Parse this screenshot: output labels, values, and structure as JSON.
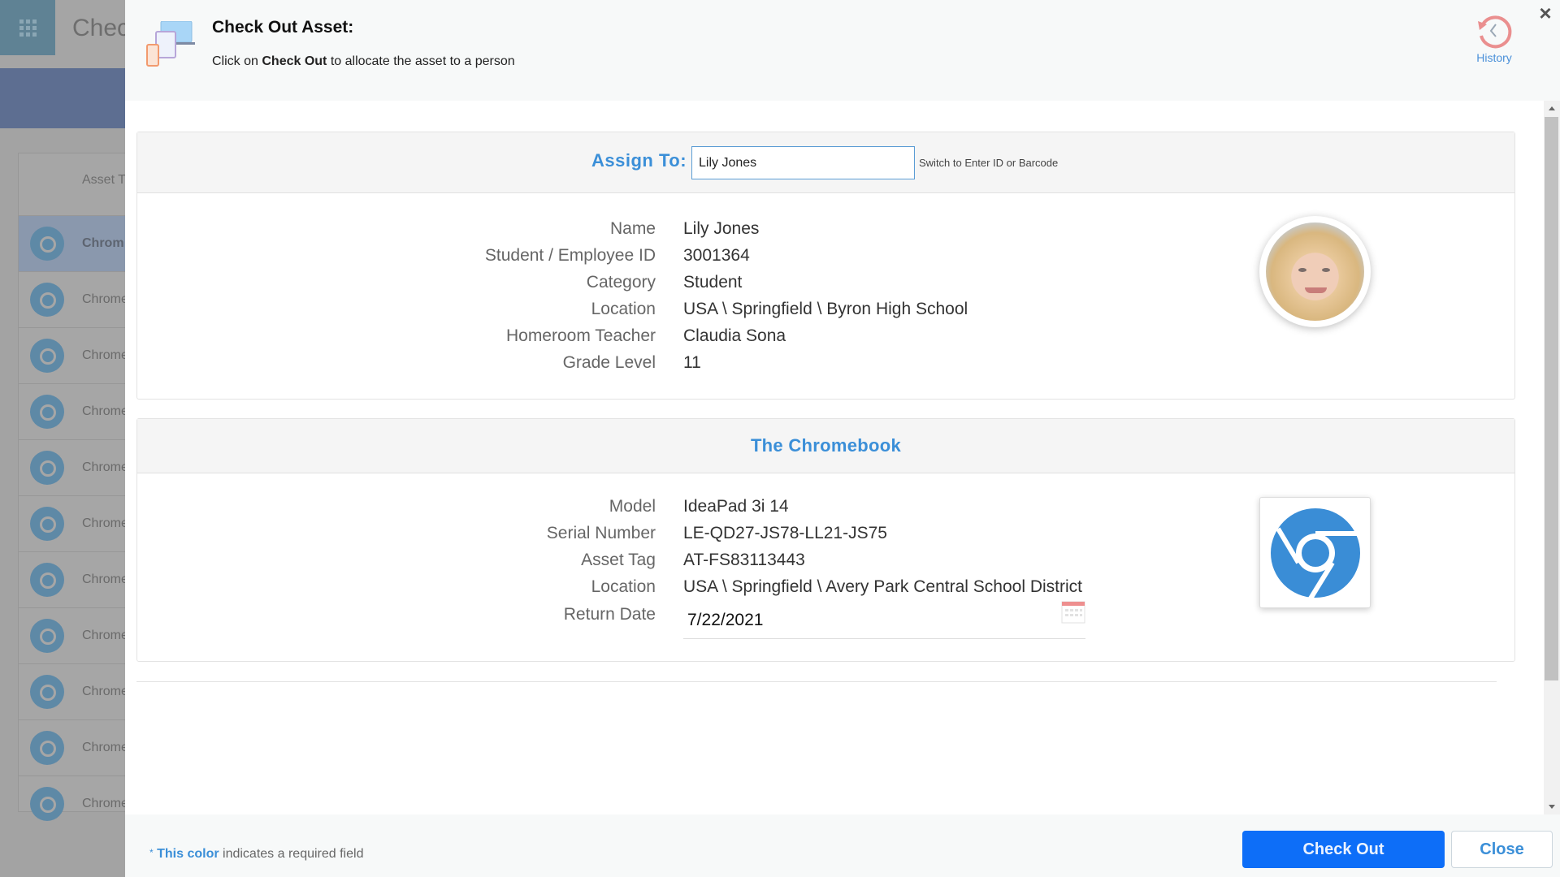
{
  "background": {
    "app_title": "Chec",
    "table_header": "Asset T",
    "rows": [
      "Chrom",
      "Chrome",
      "Chrome",
      "Chrome",
      "Chrome",
      "Chrome",
      "Chrome",
      "Chrome",
      "Chrome",
      "Chrome",
      "Chrome"
    ]
  },
  "modal": {
    "title": "Check Out Asset:",
    "subtitle_prefix": "Click on ",
    "subtitle_bold": "Check Out",
    "subtitle_suffix": " to allocate the asset to a person",
    "history_label": "History",
    "close_icon": "×"
  },
  "assign": {
    "label": "Assign To:",
    "input_value": "Lily Jones",
    "switch_link": "Switch to Enter ID or Barcode"
  },
  "person": {
    "fields": [
      {
        "label": "Name",
        "value": "Lily Jones"
      },
      {
        "label": "Student / Employee ID",
        "value": "3001364"
      },
      {
        "label": "Category",
        "value": "Student"
      },
      {
        "label": "Location",
        "value": "USA \\ Springfield \\ Byron High School"
      },
      {
        "label": "Homeroom Teacher",
        "value": "Claudia Sona"
      },
      {
        "label": "Grade Level",
        "value": "11"
      }
    ]
  },
  "asset": {
    "title": "The Chromebook",
    "fields": [
      {
        "label": "Model",
        "value": "IdeaPad 3i 14"
      },
      {
        "label": "Serial Number",
        "value": "LE-QD27-JS78-LL21-JS75"
      },
      {
        "label": "Asset Tag",
        "value": "AT-FS83113443"
      },
      {
        "label": "Location",
        "value": "USA \\ Springfield \\ Avery Park Central School District"
      }
    ],
    "return_date_label": "Return Date",
    "return_date_value": "7/22/2021"
  },
  "footer": {
    "required_star": "*",
    "required_color_text": "This color",
    "required_suffix": " indicates a required field",
    "checkout_button": "Check Out",
    "close_button": "Close"
  },
  "colors": {
    "accent": "#3b8fd8",
    "primary_button": "#0d6ef8",
    "history_icon": "#e98a8a"
  }
}
